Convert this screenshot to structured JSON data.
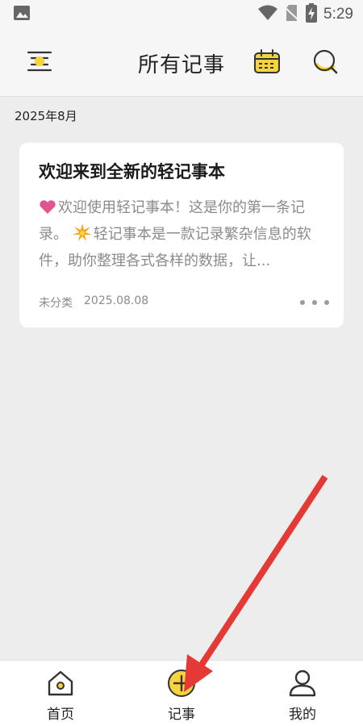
{
  "status_bar": {
    "time": "5:29",
    "icons": [
      "gallery-icon",
      "wifi-icon",
      "no-sim-icon",
      "battery-charging-icon"
    ]
  },
  "header": {
    "title": "所有记事",
    "menu_icon": "menu-icon",
    "calendar_icon": "calendar-icon",
    "search_icon": "search-icon"
  },
  "month_label": "2025年8月",
  "note": {
    "title": "欢迎来到全新的轻记事本",
    "body_part1": "欢迎使用轻记事本！这是你的第一条记录。",
    "body_part2": "轻记事本是一款记录繁杂信息的软件，助你整理各式各样的数据，让...",
    "category": "未分类",
    "date": "2025.08.08"
  },
  "bottom_nav": {
    "items": [
      {
        "label": "首页",
        "icon": "home-icon"
      },
      {
        "label": "记事",
        "icon": "add-note-icon"
      },
      {
        "label": "我的",
        "icon": "profile-icon"
      }
    ]
  },
  "colors": {
    "accent": "#f7d33f",
    "annotation_arrow": "#e53935",
    "background": "#ededed"
  }
}
